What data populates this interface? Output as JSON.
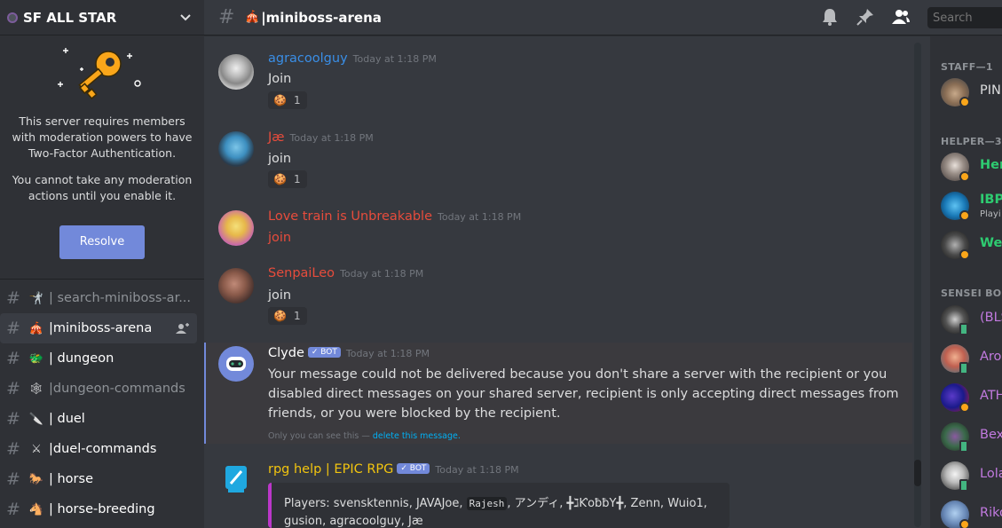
{
  "server": {
    "name": "SF ALL STAR"
  },
  "tfa": {
    "message": "This server requires members with moderation powers to have Two-Factor Authentication.",
    "notice": "You cannot take any moderation actions until you enable it.",
    "button": "Resolve"
  },
  "channels": [
    {
      "emoji": "🤺",
      "name": "| search-miniboss-ar...",
      "state": "muted"
    },
    {
      "emoji": "🎪",
      "name": "|miniboss-arena",
      "state": "active"
    },
    {
      "emoji": "🐲",
      "name": "| dungeon",
      "state": "bright"
    },
    {
      "emoji": "🕸",
      "name": "|dungeon-commands",
      "state": "muted"
    },
    {
      "emoji": "🔪",
      "name": "| duel",
      "state": "bright"
    },
    {
      "emoji": "⚔",
      "name": "|duel-commands",
      "state": "bright"
    },
    {
      "emoji": "🐎",
      "name": "| horse",
      "state": "bright"
    },
    {
      "emoji": "🐴",
      "name": "| horse-breeding",
      "state": "bright"
    }
  ],
  "header": {
    "channel_name": "|miniboss-arena",
    "channel_emoji": "🎪",
    "search_placeholder": "Search"
  },
  "messages": [
    {
      "author": "agracoolguy",
      "author_color": "#3a8ee6",
      "timestamp": "Today at 1:18 PM",
      "text": "Join",
      "reaction_emoji": "🍪",
      "reaction_count": "1"
    },
    {
      "author": "Jæ",
      "author_color": "#e74c3c",
      "timestamp": "Today at 1:18 PM",
      "text": "join",
      "reaction_emoji": "🍪",
      "reaction_count": "1"
    },
    {
      "author": "Love train is Unbreakable",
      "author_color": "#e74c3c",
      "timestamp": "Today at 1:18 PM",
      "text": "join"
    },
    {
      "author": "SenpaiLeo",
      "author_color": "#e74c3c",
      "timestamp": "Today at 1:18 PM",
      "text": "join",
      "reaction_emoji": "🍪",
      "reaction_count": "1"
    },
    {
      "author": "Clyde",
      "author_color": "#ffffff",
      "bot_tag": "✓ BOT",
      "timestamp": "Today at 1:18 PM",
      "text_line1": "Your message could not be delivered because you don't share a server with the recipient or you",
      "text_line2": "disabled direct messages on your shared server, recipient is only accepting direct messages from",
      "text_line3": "friends, or you were blocked by the recipient.",
      "ephemeral_prefix": "Only you can see this — ",
      "ephemeral_link": "delete this message."
    },
    {
      "author": "rpg help | EPIC RPG",
      "author_color": "#f1c40f",
      "bot_tag": "✓ BOT",
      "timestamp": "Today at 1:18 PM",
      "embed_prefix": "Players: svensktennis, JAVAJoe, ",
      "embed_code": "Rajesh",
      "embed_suffix": ", アンディ, ╋ℷƘoƀƀY╋, Zenn, Wuio1,",
      "embed_line2": "gusion, agracoolguy, Jæ"
    }
  ],
  "members": {
    "roles": [
      {
        "name": "STAFF—1"
      },
      {
        "name": "HELPER—3"
      },
      {
        "name": "SENSEI BOOS"
      }
    ],
    "list": [
      {
        "name": "PIN",
        "color": "#dcddde",
        "status": "idle"
      },
      {
        "name": "Her",
        "color": "#2ecc71",
        "status": "idle"
      },
      {
        "name": "IBP",
        "color": "#2ecc71",
        "status": "idle",
        "sub": "Playi"
      },
      {
        "name": "We",
        "color": "#2ecc71",
        "status": "idle"
      },
      {
        "name": "(BLS",
        "color": "#c27ae0",
        "status": "mobile"
      },
      {
        "name": "Aro",
        "color": "#c27ae0",
        "status": "mobile"
      },
      {
        "name": "ATH",
        "color": "#c27ae0",
        "status": "idle"
      },
      {
        "name": "Bex",
        "color": "#c27ae0",
        "status": "mobile"
      },
      {
        "name": "Lola",
        "color": "#c27ae0",
        "status": "mobile"
      },
      {
        "name": "Riko",
        "color": "#c27ae0",
        "status": "idle"
      }
    ]
  }
}
